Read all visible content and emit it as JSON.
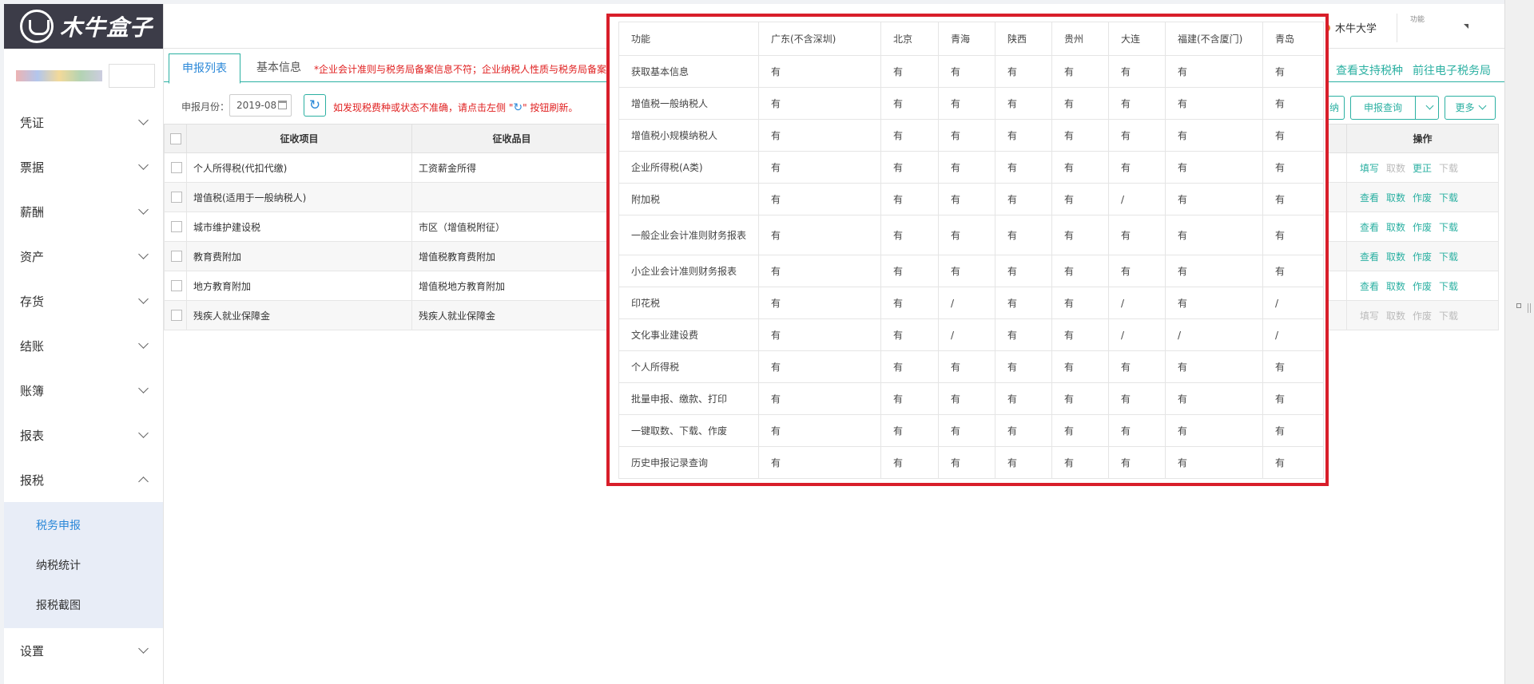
{
  "brand": {
    "name": "木牛盒子"
  },
  "header": {
    "user": "木牛大学",
    "mini_text": "功能"
  },
  "sidebar": {
    "items": [
      {
        "label": "凭证"
      },
      {
        "label": "票据"
      },
      {
        "label": "薪酬"
      },
      {
        "label": "资产"
      },
      {
        "label": "存货"
      },
      {
        "label": "结账"
      },
      {
        "label": "账簿"
      },
      {
        "label": "报表"
      }
    ],
    "open_item": {
      "label": "报税"
    },
    "sub_items": [
      {
        "label": "税务申报"
      },
      {
        "label": "纳税统计"
      },
      {
        "label": "报税截图"
      }
    ],
    "last_item": {
      "label": "设置"
    }
  },
  "tabs": {
    "active": "申报列表",
    "basic": "基本信息",
    "warning": "*企业会计准则与税务局备案信息不符；企业纳税人性质与税务局备案",
    "link_support": "查看支持税种",
    "link_etax": "前往电子税务局"
  },
  "filter": {
    "label": "申报月份：",
    "month": "2019-08",
    "refresh_icon": "↻",
    "tip_before": "如发现税费种或状态不准确，请点击左侧 \"",
    "tip_after": "\" 按钮刷新。",
    "btn_partial": "纳",
    "btn_query": "申报查询",
    "btn_more": "更多"
  },
  "grid": {
    "headers": {
      "item": "征收项目",
      "category": "征收品目",
      "ops": "操作"
    },
    "rows": [
      {
        "item": "个人所得税(代扣代缴)",
        "category": "工资薪金所得",
        "ops": [
          "填写",
          "取数",
          "更正",
          "下载"
        ]
      },
      {
        "item": "增值税(适用于一般纳税人)",
        "category": "",
        "ops": [
          "查看",
          "取数",
          "作废",
          "下载"
        ]
      },
      {
        "item": "城市维护建设税",
        "category": "市区（增值税附征）",
        "ops": [
          "查看",
          "取数",
          "作废",
          "下载"
        ]
      },
      {
        "item": "教育费附加",
        "category": "增值税教育费附加",
        "ops": [
          "查看",
          "取数",
          "作废",
          "下载"
        ]
      },
      {
        "item": "地方教育附加",
        "category": "增值税地方教育附加",
        "ops": [
          "查看",
          "取数",
          "作废",
          "下载"
        ]
      },
      {
        "item": "残疾人就业保障金",
        "category": "残疾人就业保障金",
        "ops": [
          "填写",
          "取数",
          "作废",
          "下载"
        ]
      }
    ]
  },
  "feature_table": {
    "header": [
      "功能",
      "广东(不含深圳)",
      "北京",
      "青海",
      "陕西",
      "贵州",
      "大连",
      "福建(不含厦门)",
      "青岛"
    ],
    "rows": [
      [
        "获取基本信息",
        "有",
        "有",
        "有",
        "有",
        "有",
        "有",
        "有",
        "有"
      ],
      [
        "增值税一般纳税人",
        "有",
        "有",
        "有",
        "有",
        "有",
        "有",
        "有",
        "有"
      ],
      [
        "增值税小规模纳税人",
        "有",
        "有",
        "有",
        "有",
        "有",
        "有",
        "有",
        "有"
      ],
      [
        "企业所得税(A类)",
        "有",
        "有",
        "有",
        "有",
        "有",
        "有",
        "有",
        "有"
      ],
      [
        "附加税",
        "有",
        "有",
        "有",
        "有",
        "有",
        "/",
        "有",
        "有"
      ],
      [
        "一般企业会计准则财务报表",
        "有",
        "有",
        "有",
        "有",
        "有",
        "有",
        "有",
        "有"
      ],
      [
        "小企业会计准则财务报表",
        "有",
        "有",
        "有",
        "有",
        "有",
        "有",
        "有",
        "有"
      ],
      [
        "印花税",
        "有",
        "有",
        "/",
        "有",
        "有",
        "/",
        "有",
        "/"
      ],
      [
        "文化事业建设费",
        "有",
        "有",
        "/",
        "有",
        "有",
        "/",
        "/",
        "/"
      ],
      [
        "个人所得税",
        "有",
        "有",
        "有",
        "有",
        "有",
        "有",
        "有",
        "有"
      ],
      [
        "批量申报、缴款、打印",
        "有",
        "有",
        "有",
        "有",
        "有",
        "有",
        "有",
        "有"
      ],
      [
        "一键取数、下载、作废",
        "有",
        "有",
        "有",
        "有",
        "有",
        "有",
        "有",
        "有"
      ],
      [
        "历史申报记录查询",
        "有",
        "有",
        "有",
        "有",
        "有",
        "有",
        "有",
        "有"
      ]
    ]
  },
  "colors": {
    "accent": "#2bb0a2",
    "link": "#2b88d8",
    "warning": "#e02020",
    "highlight_border": "#d81e2a",
    "logo_bg": "#3c3c48"
  }
}
